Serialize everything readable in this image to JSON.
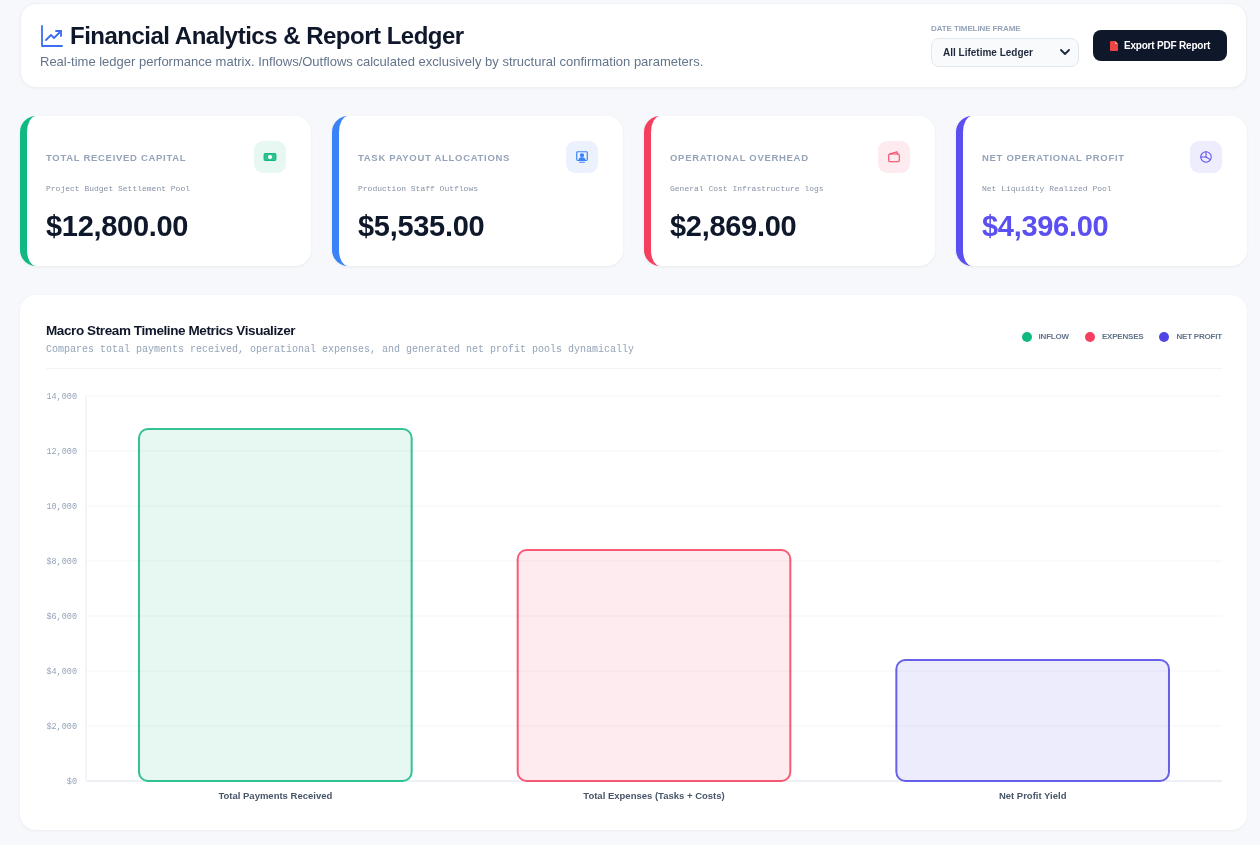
{
  "header": {
    "title": "Financial Analytics & Report Ledger",
    "subtitle": "Real-time ledger performance matrix. Inflows/Outflows calculated exclusively by structural confirmation parameters.",
    "date_filter": {
      "label": "DATE TIMELINE FRAME",
      "value": "All Lifetime Ledger"
    },
    "export_button": "Export PDF Report"
  },
  "cards": [
    {
      "kind": "income",
      "title": "TOTAL RECEIVED CAPITAL",
      "subtitle": "Project Budget Settlement Pool",
      "value": "$12,800.00",
      "color": "#10b981",
      "highlighted": false
    },
    {
      "kind": "payout",
      "title": "TASK PAYOUT ALLOCATIONS",
      "subtitle": "Production Staff Outflows",
      "value": "$5,535.00",
      "color": "#3b82f6",
      "highlighted": false
    },
    {
      "kind": "overhead",
      "title": "OPERATIONAL OVERHEAD",
      "subtitle": "General Cost Infrastructure logs",
      "value": "$2,869.00",
      "color": "#f43f5e",
      "highlighted": false
    },
    {
      "kind": "profit",
      "title": "NET OPERATIONAL PROFIT",
      "subtitle": "Net Liquidity Realized Pool",
      "value": "$4,396.00",
      "color": "#5b4ff0",
      "highlighted": true
    }
  ],
  "chart_panel": {
    "title": "Macro Stream Timeline Metrics Visualizer",
    "subtitle": "Compares total payments received, operational expenses, and generated net profit pools dynamically",
    "legend": [
      {
        "label": "INFLOW",
        "color": "#10b981"
      },
      {
        "label": "EXPENSES",
        "color": "#f43f5e"
      },
      {
        "label": "NET PROFIT",
        "color": "#4f46e5"
      }
    ],
    "chart_data": {
      "type": "bar",
      "categories": [
        "Total Payments Received",
        "Total Expenses (Tasks + Costs)",
        "Net Profit Yield"
      ],
      "values": [
        12800,
        8400,
        4400
      ],
      "ylim": [
        0,
        14000
      ],
      "yticks": [
        {
          "value": 0,
          "label": "$0"
        },
        {
          "value": 2000,
          "label": "$2,000"
        },
        {
          "value": 4000,
          "label": "$4,000"
        },
        {
          "value": 6000,
          "label": "$6,000"
        },
        {
          "value": 8000,
          "label": "$8,000"
        },
        {
          "value": 10000,
          "label": "10,000"
        },
        {
          "value": 12000,
          "label": "12,000"
        },
        {
          "value": 14000,
          "label": "14,000"
        }
      ],
      "grid": true
    }
  }
}
